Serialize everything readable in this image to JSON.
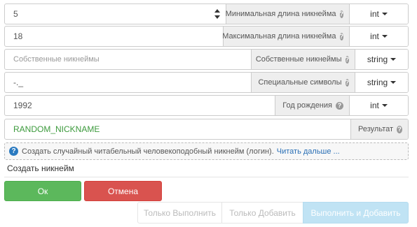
{
  "fields": [
    {
      "value": "5",
      "label": "Минимальная длина никнейма",
      "type": "int"
    },
    {
      "value": "18",
      "label": "Максимальная длина никнейма",
      "type": "int"
    },
    {
      "placeholder": "Собственные никнеймы",
      "label": "Собственные никнеймы",
      "type": "string"
    },
    {
      "value": "-._",
      "label": "Специальные символы",
      "type": "string"
    },
    {
      "value": "1992",
      "label": "Год рождения",
      "type": "int"
    }
  ],
  "result": {
    "value": "RANDOM_NICKNAME",
    "label": "Результат"
  },
  "info": {
    "icon": "question-circle-icon",
    "text": "Создать случайный читабельный человекоподобный никнейм (логин).",
    "link": "Читать дальше ..."
  },
  "section_title": "Создать никнейм",
  "buttons": {
    "ok": "Ок",
    "cancel": "Отмена",
    "run_only": "Только Выполнить",
    "add_only": "Только Добавить",
    "run_and_add": "Выполнить и Добавить"
  },
  "colors": {
    "ok": "#5cb85c",
    "cancel": "#d9534f",
    "result_text": "#3c9a3c",
    "link": "#2a6fb5",
    "run_add_disabled": "#c0e3f4"
  }
}
